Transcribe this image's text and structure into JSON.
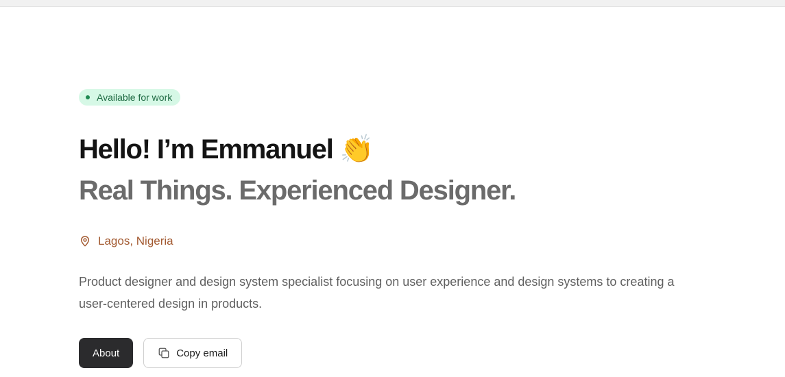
{
  "status": {
    "label": "Available for work"
  },
  "hero": {
    "greeting": "Hello! I’m Emmanuel",
    "wave_emoji": "👏",
    "tagline": "Real Things. Experienced Designer."
  },
  "location": {
    "icon": "map-pin-icon",
    "label": "Lagos, Nigeria"
  },
  "bio": "Product designer and design system specialist focusing on user experience and design systems to creating a user-centered design in products.",
  "actions": {
    "about_label": "About",
    "copy_email_label": "Copy email",
    "copy_icon": "copy-icon"
  },
  "colors": {
    "badge_bg": "#d6f8e6",
    "badge_text": "#1f6b43",
    "location": "#a35a31",
    "primary_button": "#2b2b2d"
  }
}
